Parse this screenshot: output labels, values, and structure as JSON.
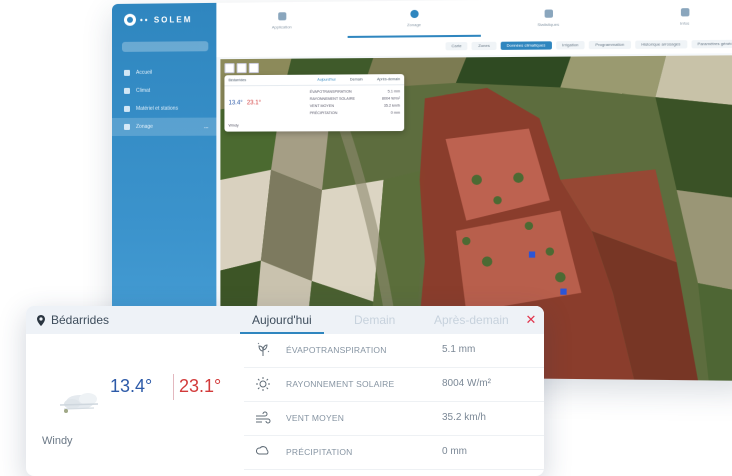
{
  "app": {
    "logo_text": "•• SOLEM",
    "sidebar": {
      "items": [
        {
          "label": "Accueil"
        },
        {
          "label": "Climat"
        },
        {
          "label": "Matériel et stations"
        },
        {
          "label": "Zonage",
          "meta": "•••"
        }
      ]
    },
    "top_tabs": [
      {
        "label": "Application"
      },
      {
        "label": "Zonage"
      },
      {
        "label": "Statistiques"
      },
      {
        "label": "Infos"
      }
    ],
    "toolbar": [
      "Carte",
      "Zones",
      "Données climatiques",
      "Irrigation",
      "Programmation",
      "Historique arrosages",
      "Paramètres généraux"
    ],
    "mini_popup": {
      "location": "Bédarrides",
      "tabs": [
        "Aujourd'hui",
        "Demain",
        "Après-demain"
      ],
      "tmin": "13.4°",
      "tmax": "23.1°",
      "condition": "Windy",
      "rows": [
        {
          "label": "ÉVAPOTRANSPIRATION",
          "value": "5.1 mm"
        },
        {
          "label": "RAYONNEMENT SOLAIRE",
          "value": "8004 W/m²"
        },
        {
          "label": "VENT MOYEN",
          "value": "35.2 km/h"
        },
        {
          "label": "PRÉCIPITATION",
          "value": "0 mm"
        }
      ]
    }
  },
  "card": {
    "location": "Bédarrides",
    "tabs": {
      "today": "Aujourd'hui",
      "tomorrow": "Demain",
      "after": "Après-demain"
    },
    "close_glyph": "✕",
    "tmin": "13.4°",
    "tmax": "23.1°",
    "condition": "Windy",
    "rows": [
      {
        "icon": "evapotranspiration-icon",
        "label": "ÉVAPOTRANSPIRATION",
        "value": "5.1 mm"
      },
      {
        "icon": "sun-icon",
        "label": "RAYONNEMENT SOLAIRE",
        "value": "8004 W/m²"
      },
      {
        "icon": "wind-icon",
        "label": "VENT MOYEN",
        "value": "35.2 km/h"
      },
      {
        "icon": "rain-icon",
        "label": "PRÉCIPITATION",
        "value": "0 mm"
      }
    ]
  },
  "colors": {
    "accent": "#2f86bf",
    "temp_min": "#2d5aa8",
    "temp_max": "#d23a3a",
    "close": "#e2364e"
  }
}
